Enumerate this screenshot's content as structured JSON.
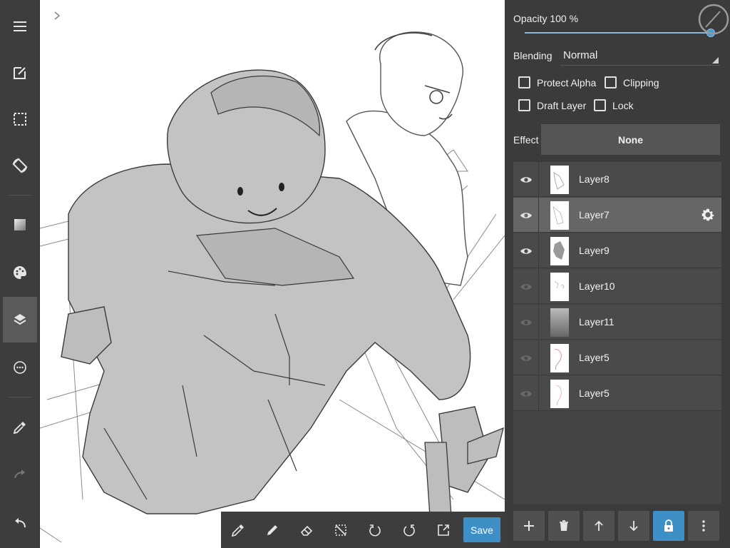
{
  "left_toolbar": {
    "items": [
      {
        "icon": "menu-icon"
      },
      {
        "icon": "edit-icon"
      },
      {
        "icon": "selection-icon"
      },
      {
        "icon": "rotate-canvas-icon"
      },
      {
        "icon": "gradient-icon"
      },
      {
        "icon": "palette-icon"
      },
      {
        "icon": "layers-icon",
        "active": true
      },
      {
        "icon": "more-options-icon"
      },
      {
        "icon": "eyedropper-icon"
      },
      {
        "icon": "redo-icon"
      },
      {
        "icon": "undo-icon"
      }
    ]
  },
  "bottom_toolbar": {
    "tools": [
      "eyedropper-icon",
      "pen-icon",
      "eraser-icon",
      "deselect-icon",
      "rotate-left-icon",
      "rotate-right-icon",
      "export-icon"
    ],
    "save_label": "Save"
  },
  "layer_properties": {
    "opacity_label": "Opacity 100 %",
    "opacity_value": 100,
    "blending_label": "Blending",
    "blending_value": "Normal",
    "checkboxes": {
      "protect_alpha": "Protect Alpha",
      "clipping": "Clipping",
      "draft_layer": "Draft Layer",
      "lock": "Lock"
    },
    "effect_label": "Effect",
    "effect_value": "None"
  },
  "layers": [
    {
      "name": "Layer8",
      "visible": true,
      "selected": false
    },
    {
      "name": "Layer7",
      "visible": true,
      "selected": true
    },
    {
      "name": "Layer9",
      "visible": true,
      "selected": false
    },
    {
      "name": "Layer10",
      "visible": false,
      "selected": false
    },
    {
      "name": "Layer11",
      "visible": false,
      "selected": false
    },
    {
      "name": "Layer5",
      "visible": false,
      "selected": false
    },
    {
      "name": "Layer5",
      "visible": false,
      "selected": false
    }
  ],
  "layer_toolbar": [
    "add-layer-icon",
    "delete-layer-icon",
    "move-up-icon",
    "move-down-icon",
    "lock-icon",
    "more-vertical-icon"
  ],
  "colors": {
    "accent": "#3f8fc7",
    "panel_bg": "#3b3b3b",
    "selected_row": "#666666"
  }
}
